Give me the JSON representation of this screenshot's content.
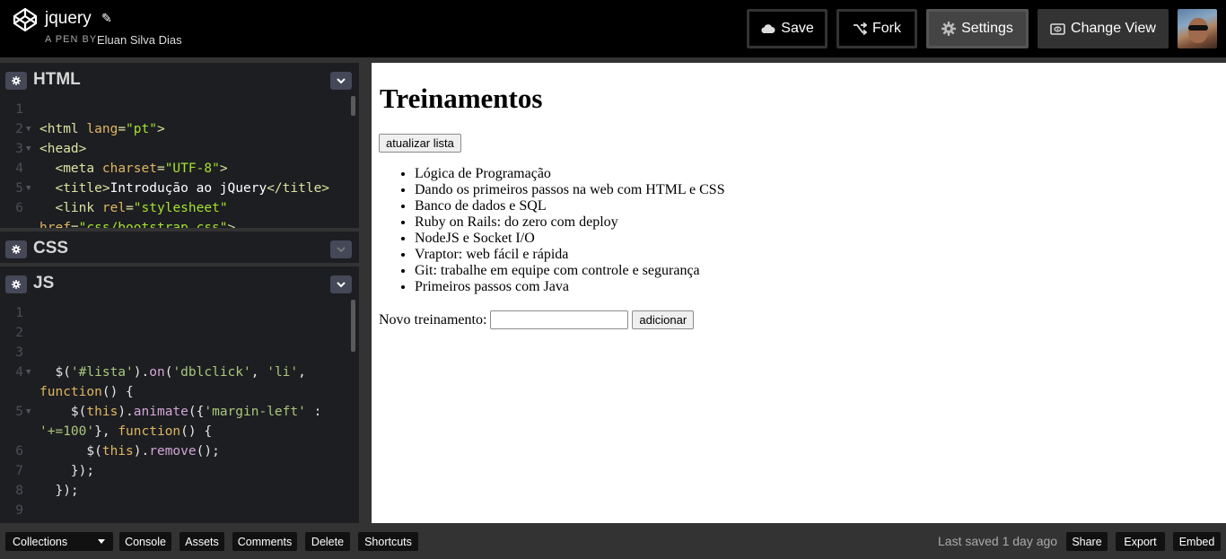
{
  "header": {
    "pen_title": "jquery",
    "pen_by_prefix": "A PEN BY",
    "author": "Eluan Silva Dias",
    "buttons": {
      "save": "Save",
      "fork": "Fork",
      "settings": "Settings",
      "change_view": "Change View"
    }
  },
  "editors": {
    "html": {
      "label": "HTML",
      "lines": [
        {
          "n": "1",
          "fold": false,
          "parts": []
        },
        {
          "n": "2",
          "fold": true,
          "parts": [
            [
              "t-tag",
              "<html "
            ],
            [
              "t-attr",
              "lang"
            ],
            [
              "t-tag",
              "="
            ],
            [
              "t-str",
              "\"pt\""
            ],
            [
              "t-tag",
              ">"
            ]
          ]
        },
        {
          "n": "3",
          "fold": true,
          "parts": [
            [
              "t-tag",
              "<head>"
            ]
          ]
        },
        {
          "n": "4",
          "fold": false,
          "parts": [
            [
              "t-plain",
              "  "
            ],
            [
              "t-tag",
              "<meta "
            ],
            [
              "t-attr",
              "charset"
            ],
            [
              "t-tag",
              "="
            ],
            [
              "t-str",
              "\"UTF-8\""
            ],
            [
              "t-tag",
              ">"
            ]
          ]
        },
        {
          "n": "5",
          "fold": true,
          "parts": [
            [
              "t-plain",
              "  "
            ],
            [
              "t-tag",
              "<title>"
            ],
            [
              "t-white",
              "Introdução ao jQuery"
            ],
            [
              "t-tag",
              "</title>"
            ]
          ]
        },
        {
          "n": "6",
          "fold": false,
          "parts": [
            [
              "t-plain",
              "  "
            ],
            [
              "t-tag",
              "<link "
            ],
            [
              "t-attr",
              "rel"
            ],
            [
              "t-tag",
              "="
            ],
            [
              "t-str",
              "\"stylesheet\""
            ]
          ]
        },
        {
          "n": "",
          "fold": false,
          "parts": [
            [
              "t-attr",
              "href"
            ],
            [
              "t-tag",
              "="
            ],
            [
              "t-str",
              "\"css/bootstrap.css\""
            ],
            [
              "t-tag",
              ">"
            ]
          ]
        }
      ]
    },
    "css": {
      "label": "CSS"
    },
    "js": {
      "label": "JS",
      "lines": [
        {
          "n": "1",
          "fold": false,
          "parts": []
        },
        {
          "n": "2",
          "fold": false,
          "parts": []
        },
        {
          "n": "3",
          "fold": false,
          "parts": []
        },
        {
          "n": "4",
          "fold": true,
          "parts": [
            [
              "t-plain",
              "  $("
            ],
            [
              "t-js-str",
              "'#lista'"
            ],
            [
              "t-plain",
              ")."
            ],
            [
              "t-fn",
              "on"
            ],
            [
              "t-plain",
              "("
            ],
            [
              "t-js-str",
              "'dblclick'"
            ],
            [
              "t-plain",
              ", "
            ],
            [
              "t-js-str",
              "'li'"
            ],
            [
              "t-plain",
              ","
            ]
          ]
        },
        {
          "n": "",
          "fold": false,
          "parts": [
            [
              "t-kw",
              "function"
            ],
            [
              "t-plain",
              "() {"
            ]
          ]
        },
        {
          "n": "5",
          "fold": true,
          "parts": [
            [
              "t-plain",
              "    $("
            ],
            [
              "t-kw",
              "this"
            ],
            [
              "t-plain",
              ")."
            ],
            [
              "t-fn",
              "animate"
            ],
            [
              "t-plain",
              "({"
            ],
            [
              "t-js-str",
              "'margin-left'"
            ],
            [
              "t-plain",
              " :"
            ]
          ]
        },
        {
          "n": "",
          "fold": false,
          "parts": [
            [
              "t-js-str",
              "'+=100'"
            ],
            [
              "t-plain",
              "}, "
            ],
            [
              "t-kw",
              "function"
            ],
            [
              "t-plain",
              "() {"
            ]
          ]
        },
        {
          "n": "6",
          "fold": false,
          "parts": [
            [
              "t-plain",
              "      $("
            ],
            [
              "t-kw",
              "this"
            ],
            [
              "t-plain",
              ")."
            ],
            [
              "t-fn",
              "remove"
            ],
            [
              "t-plain",
              "();"
            ]
          ]
        },
        {
          "n": "7",
          "fold": false,
          "parts": [
            [
              "t-plain",
              "    });"
            ]
          ]
        },
        {
          "n": "8",
          "fold": false,
          "parts": [
            [
              "t-plain",
              "  });"
            ]
          ]
        },
        {
          "n": "9",
          "fold": false,
          "parts": []
        }
      ]
    }
  },
  "preview": {
    "heading": "Treinamentos",
    "refresh_button": "atualizar lista",
    "items": [
      "Lógica de Programação",
      "Dando os primeiros passos na web com HTML e CSS",
      "Banco de dados e SQL",
      "Ruby on Rails: do zero com deploy",
      "NodeJS e Socket I/O",
      "Vraptor: web fácil e rápida",
      "Git: trabalhe em equipe com controle e segurança",
      "Primeiros passos com Java"
    ],
    "new_label": "Novo treinamento:",
    "new_value": "",
    "add_button": "adicionar"
  },
  "footer": {
    "collections": "Collections",
    "left_buttons": [
      "Console",
      "Assets",
      "Comments",
      "Delete",
      "Shortcuts"
    ],
    "last_saved": "Last saved 1 day ago",
    "right_buttons": [
      "Share",
      "Export",
      "Embed"
    ]
  }
}
